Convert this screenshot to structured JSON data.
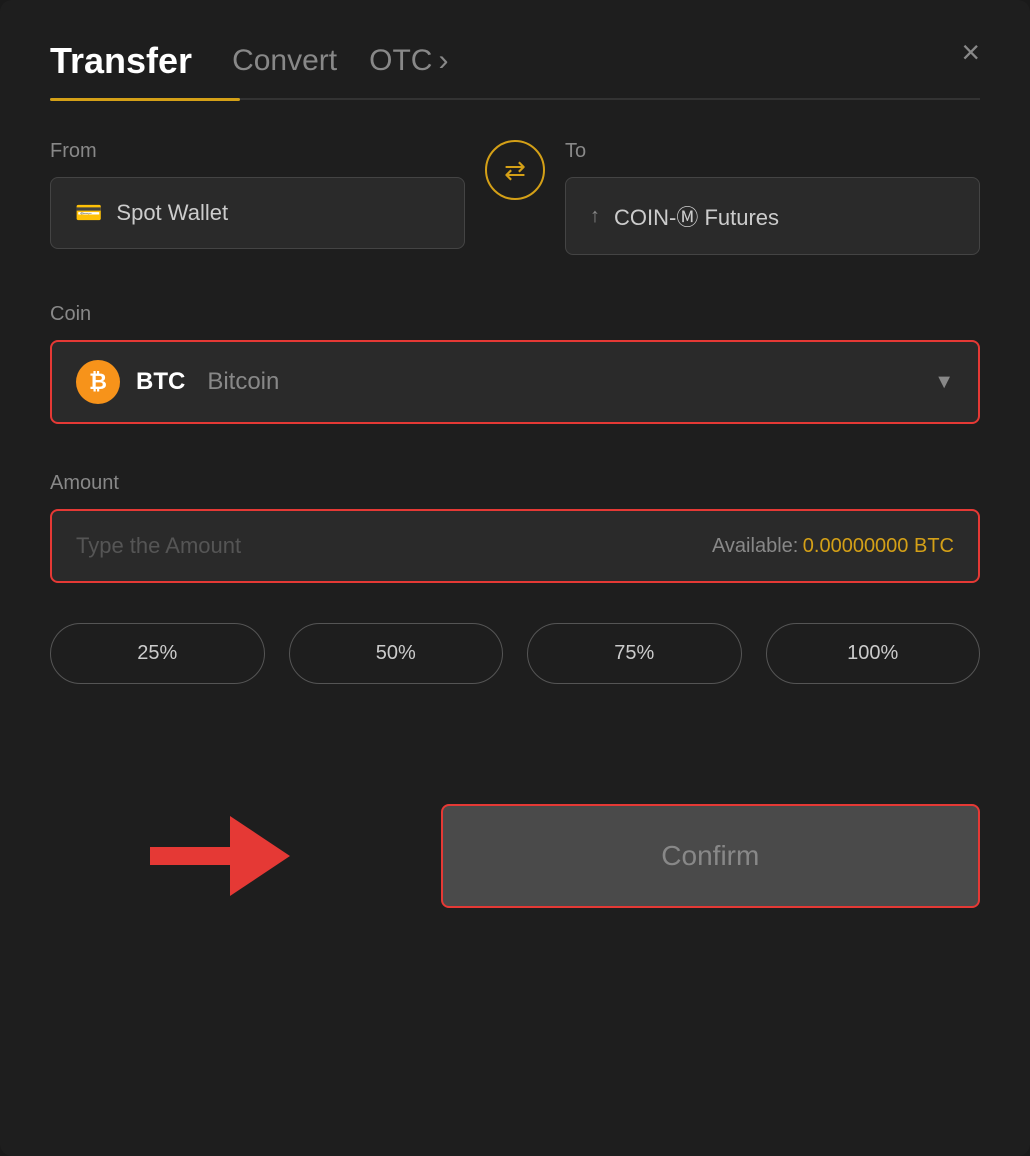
{
  "header": {
    "tab_transfer": "Transfer",
    "tab_convert": "Convert",
    "tab_otc": "OTC",
    "tab_otc_arrow": "›",
    "close_label": "×"
  },
  "from": {
    "label": "From",
    "wallet": "Spot Wallet",
    "wallet_icon": "💳"
  },
  "to": {
    "label": "To",
    "wallet": "COIN-Ⓜ Futures",
    "wallet_icon": "↑"
  },
  "swap": {
    "icon": "⇄"
  },
  "coin": {
    "label": "Coin",
    "symbol": "BTC",
    "name": "Bitcoin"
  },
  "amount": {
    "label": "Amount",
    "placeholder": "Type the Amount",
    "available_label": "Available:",
    "available_value": "0.00000000",
    "available_currency": "BTC"
  },
  "percentages": [
    {
      "label": "25%",
      "value": 25
    },
    {
      "label": "50%",
      "value": 50
    },
    {
      "label": "75%",
      "value": 75
    },
    {
      "label": "100%",
      "value": 100
    }
  ],
  "confirm": {
    "label": "Confirm"
  }
}
